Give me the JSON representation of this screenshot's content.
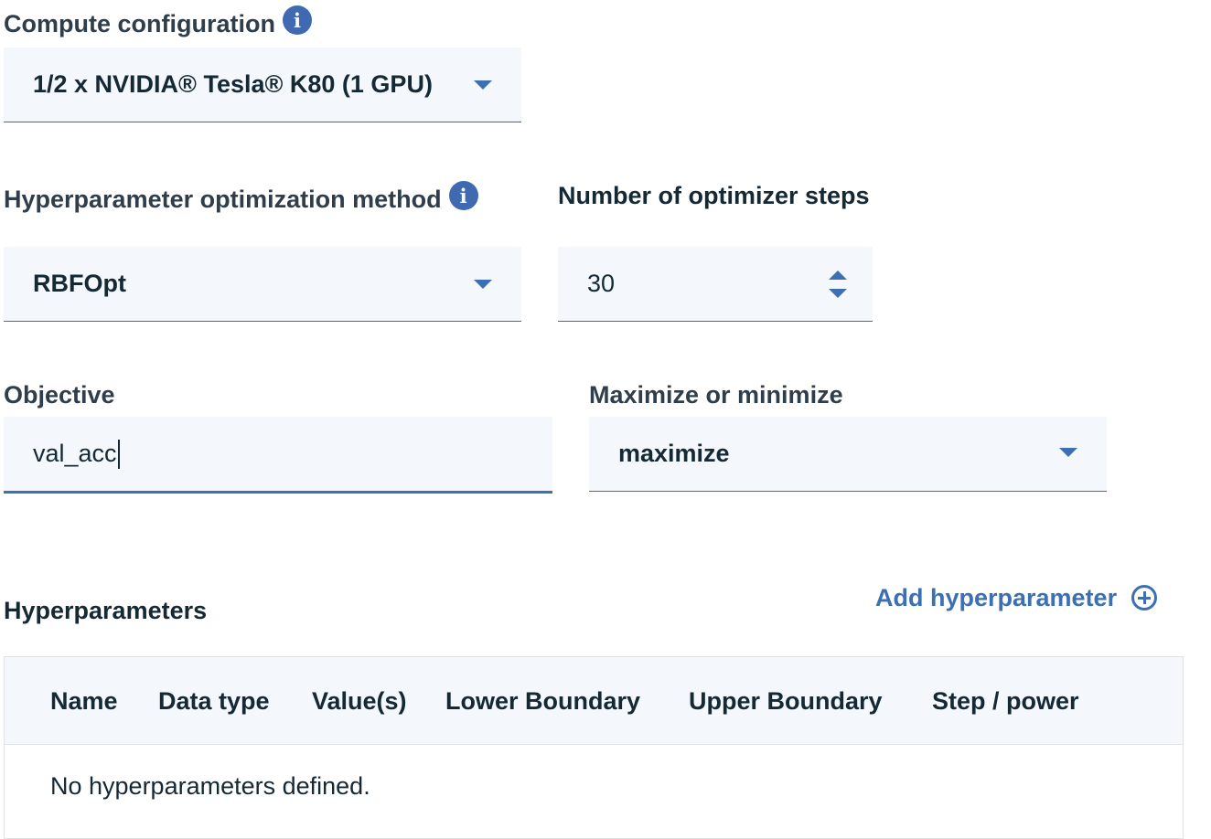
{
  "compute": {
    "label": "Compute configuration",
    "info_icon": "info-icon",
    "value": "1/2 x NVIDIA® Tesla® K80 (1 GPU)"
  },
  "hpo_method": {
    "label": "Hyperparameter optimization method",
    "info_icon": "info-icon",
    "value": "RBFOpt"
  },
  "optimizer_steps": {
    "label": "Number of optimizer steps",
    "value": "30"
  },
  "objective": {
    "label": "Objective",
    "value": "val_acc"
  },
  "max_min": {
    "label": "Maximize or minimize",
    "value": "maximize"
  },
  "hyperparameters": {
    "title": "Hyperparameters",
    "add_label": "Add hyperparameter",
    "columns": [
      "Name",
      "Data type",
      "Value(s)",
      "Lower Boundary",
      "Upper Boundary",
      "Step / power"
    ],
    "empty_message": "No hyperparameters defined."
  },
  "colors": {
    "accent": "#3d70b2",
    "field_bg": "#f4f7fb",
    "text": "#152935"
  }
}
